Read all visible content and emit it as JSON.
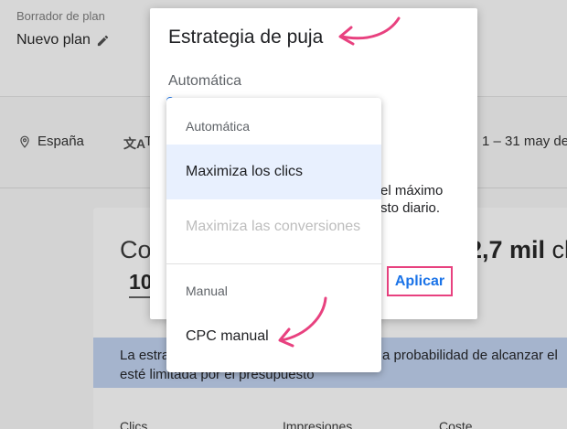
{
  "background": {
    "plan_label": "Borrador de plan",
    "plan_name": "Nuevo plan",
    "location": "España",
    "language_tail": "T",
    "date_range": "1 – 31 may de",
    "card_title_left": "Co",
    "card_number_left": "10",
    "card_title_right_value": "2,7 mil",
    "card_title_right_suffix": " cl",
    "banner_line1_left": "La estra",
    "banner_line1_right": "a probabilidad de alcanzar el",
    "banner_line2": "esté limitada por el presupuesto",
    "columns": [
      "Clics",
      "Impresiones",
      "Coste"
    ]
  },
  "dialog": {
    "title": "Estrategia de puja",
    "field_label": "Automática",
    "body_line1": "el máximo",
    "body_line2": "sto diario.",
    "apply_label": "Aplicar"
  },
  "menu": {
    "group_auto": "Automática",
    "items_auto": [
      {
        "label": "Maximiza los clics",
        "selected": true,
        "disabled": false
      },
      {
        "label": "Maximiza las conversiones",
        "selected": false,
        "disabled": true
      }
    ],
    "group_manual": "Manual",
    "items_manual": [
      {
        "label": "CPC manual",
        "selected": false,
        "disabled": false
      }
    ]
  },
  "colors": {
    "accent": "#1a73e8",
    "annotation": "#e8417f",
    "selected_bg": "#e8f0fe",
    "banner_bg": "#a5b4cd"
  }
}
